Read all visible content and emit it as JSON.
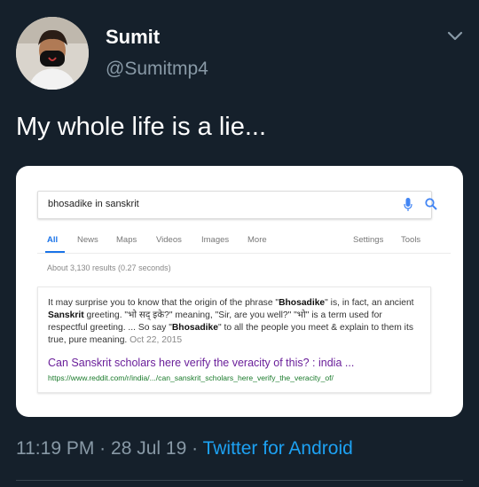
{
  "tweet": {
    "author_name": "Sumit",
    "handle": "@Sumitmp4",
    "text": "My whole life is a lie...",
    "time": "11:19 PM",
    "separator": "·",
    "date": "28 Jul 19",
    "client": "Twitter for Android"
  },
  "search_card": {
    "query": "bhosadike in sanskrit",
    "tabs": [
      "All",
      "News",
      "Maps",
      "Videos",
      "Images",
      "More"
    ],
    "right_tabs": [
      "Settings",
      "Tools"
    ],
    "active_tab": "All",
    "result_stats": "About 3,130 results (0.27 seconds)",
    "snippet": {
      "part1": "It may surprise you to know that the origin of the phrase \"",
      "bold1": "Bhosadike",
      "part2": "\" is, in fact, an ancient ",
      "bold2": "Sanskrit",
      "part3": " greeting. \"भो सद् इके?\" meaning, \"Sir, are you well?\" \"भो\" is a term used for respectful greeting. ... So say \"",
      "bold3": "Bhosadike",
      "part4": "\" to all the people you meet & explain to them its true, pure meaning.",
      "date": "Oct 22, 2015"
    },
    "result_title": "Can Sanskrit scholars here verify the veracity of this? : india ...",
    "result_url": "https://www.reddit.com/r/india/.../can_sanskrit_scholars_here_verify_the_veracity_of/"
  },
  "icons": {
    "menu": "chevron-down-icon",
    "mic": "mic-icon",
    "search": "search-icon"
  },
  "colors": {
    "background": "#15202b",
    "secondary_text": "#8899a6",
    "link": "#1da1f2",
    "google_blue": "#1a73e8",
    "result_title": "#6a1f9a",
    "result_url": "#1a7a2b"
  }
}
